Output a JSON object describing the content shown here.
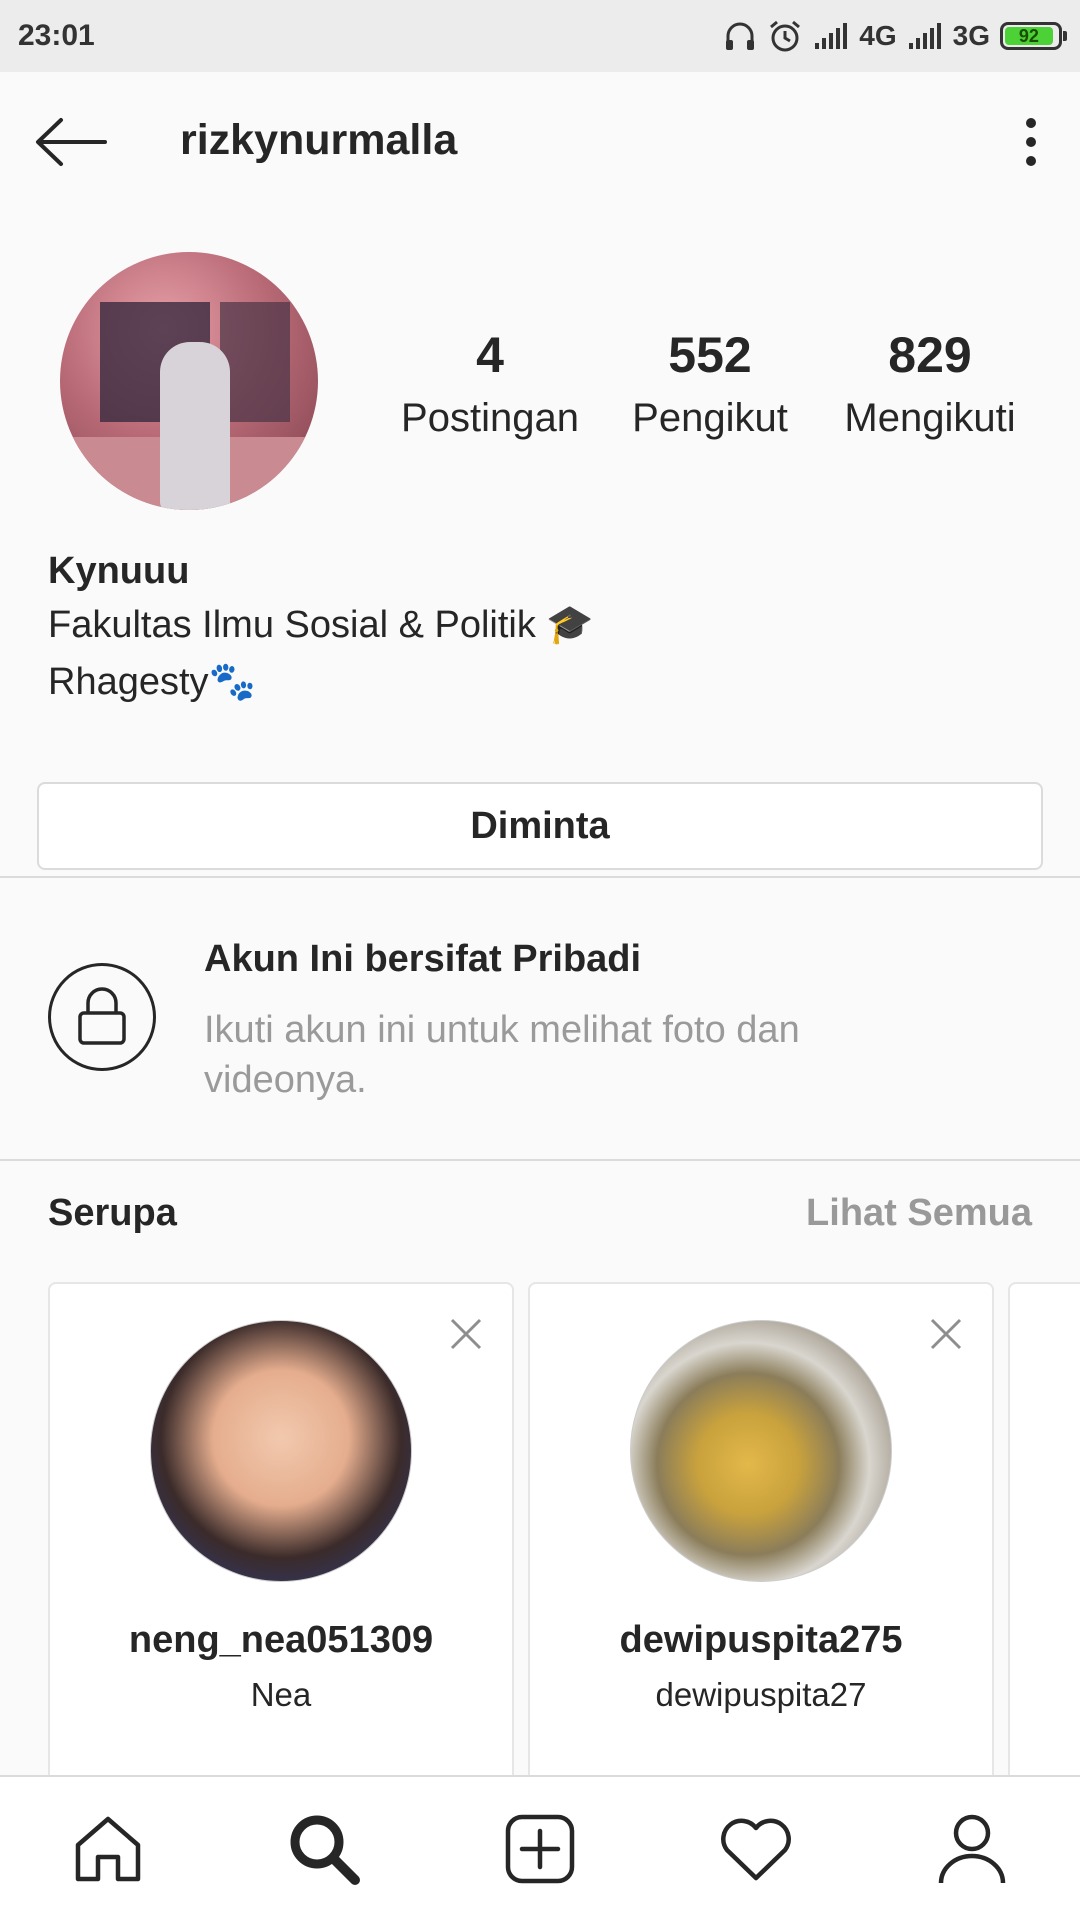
{
  "status_bar": {
    "time": "23:01",
    "network_1": "4G",
    "network_2": "3G",
    "battery": "92",
    "icons": [
      "headphones-icon",
      "alarm-icon",
      "signal-icon",
      "signal-icon",
      "battery-icon"
    ]
  },
  "header": {
    "username": "rizkynurmalla",
    "back_icon": "back-arrow-icon",
    "more_icon": "more-vertical-icon"
  },
  "profile": {
    "stats": [
      {
        "value": "4",
        "label": "Postingan"
      },
      {
        "value": "552",
        "label": "Pengikut"
      },
      {
        "value": "829",
        "label": "Mengikuti"
      }
    ],
    "name": "Kynuuu",
    "bio_line_1": "Fakultas Ilmu Sosial & Politik 🎓",
    "bio_line_2": "Rhagesty🐾",
    "follow_button_label": "Diminta"
  },
  "private_notice": {
    "title": "Akun Ini bersifat Pribadi",
    "description": "Ikuti akun ini untuk melihat foto dan videonya."
  },
  "similar": {
    "title": "Serupa",
    "see_all": "Lihat Semua",
    "cards": [
      {
        "username": "neng_nea051309",
        "subtitle": "Nea"
      },
      {
        "username": "dewipuspita275",
        "subtitle": "dewipuspita27"
      }
    ]
  },
  "bottom_nav": [
    "home-icon",
    "search-icon",
    "add-post-icon",
    "heart-icon",
    "profile-icon"
  ],
  "colors": {
    "text": "#262626",
    "muted": "#9a9a9a",
    "border": "#dbdbdb",
    "battery": "#4cd137"
  }
}
